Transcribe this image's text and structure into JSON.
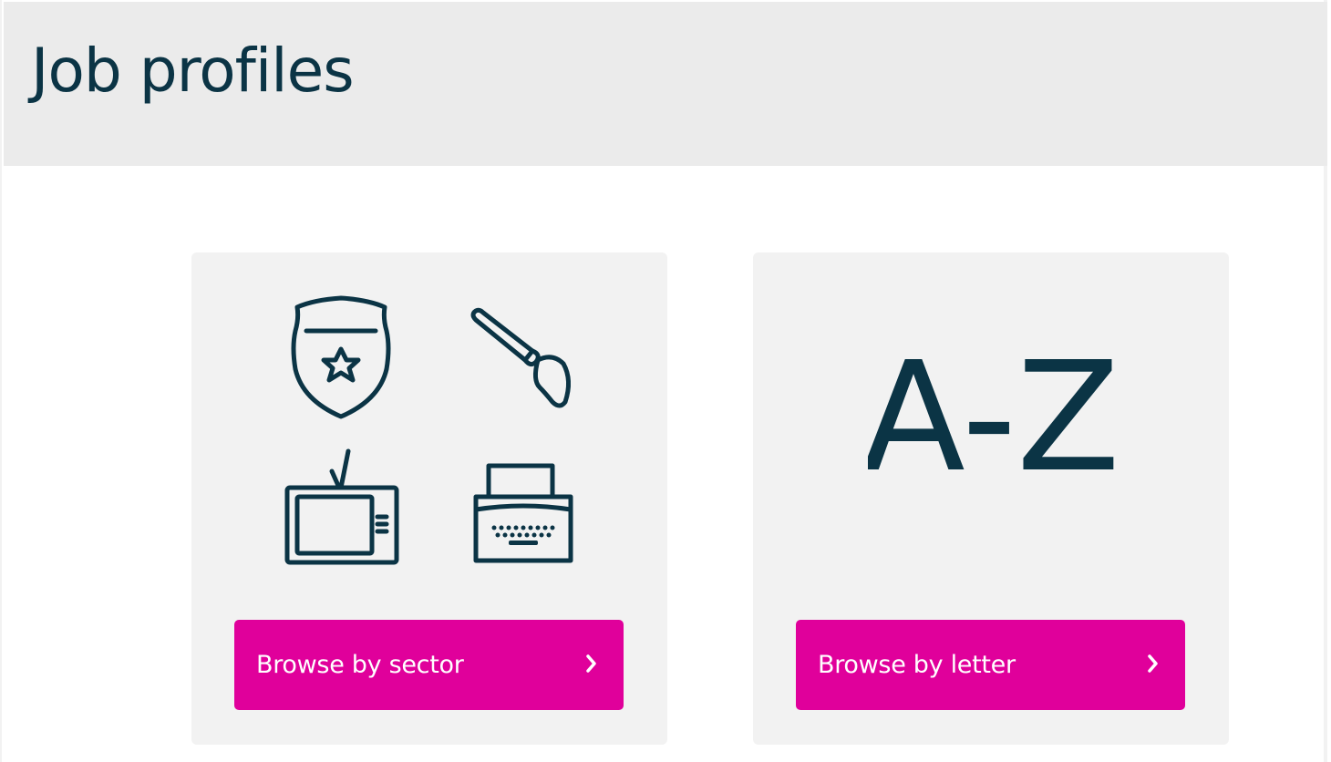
{
  "header": {
    "title": "Job profiles"
  },
  "cards": {
    "sector": {
      "icons": [
        "police-badge-icon",
        "paintbrush-icon",
        "television-icon",
        "typewriter-icon"
      ],
      "button_label": "Browse by sector"
    },
    "letter": {
      "graphic": "A-Z",
      "button_label": "Browse by letter"
    }
  },
  "colors": {
    "header_bg": "#ebebeb",
    "card_bg": "#f2f2f2",
    "ink": "#0b3445",
    "accent": "#e0009b"
  }
}
